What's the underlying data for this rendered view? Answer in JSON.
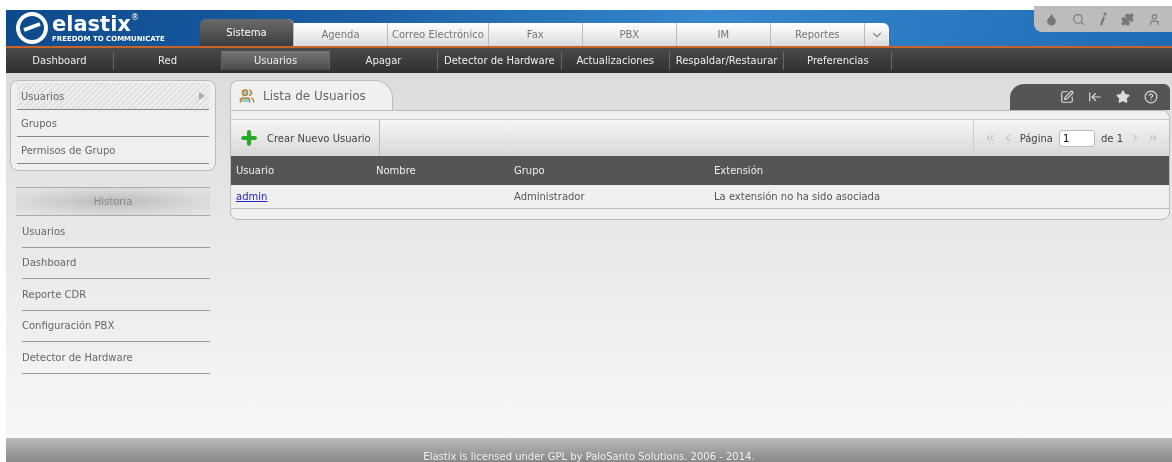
{
  "logo": {
    "name": "elastix",
    "mark": "®",
    "tagline": "FREEDOM TO COMMUNICATE"
  },
  "tabs": [
    {
      "label": "Sistema",
      "selected": true
    },
    {
      "label": "Agenda",
      "selected": false
    },
    {
      "label": "Correo Electrónico",
      "selected": false
    },
    {
      "label": "Fax",
      "selected": false
    },
    {
      "label": "PBX",
      "selected": false
    },
    {
      "label": "IM",
      "selected": false
    },
    {
      "label": "Reportes",
      "selected": false
    }
  ],
  "subnav": [
    {
      "label": "Dashboard",
      "selected": false
    },
    {
      "label": "Red",
      "selected": false
    },
    {
      "label": "Usuarios",
      "selected": true
    },
    {
      "label": "Apagar",
      "selected": false
    },
    {
      "label": "Detector de Hardware",
      "selected": false
    },
    {
      "label": "Actualizaciones",
      "selected": false
    },
    {
      "label": "Respaldar/Restaurar",
      "selected": false
    },
    {
      "label": "Preferencias",
      "selected": false
    }
  ],
  "sidebar": {
    "items": [
      {
        "label": "Usuarios",
        "selected": true
      },
      {
        "label": "Grupos",
        "selected": false
      },
      {
        "label": "Permisos de Grupo",
        "selected": false
      }
    ],
    "history_title": "Historia",
    "history": [
      "Usuarios",
      "Dashboard",
      "Reporte CDR",
      "Configuración PBX",
      "Detector de Hardware"
    ]
  },
  "panel": {
    "title": "Lista de Usuarios",
    "create_button": "Crear Nuevo Usuario",
    "pager": {
      "label": "Página",
      "page": "1",
      "of": "de 1"
    },
    "table": {
      "columns": [
        "Usuario",
        "Nombre",
        "Grupo",
        "Extensión"
      ],
      "rows": [
        {
          "user": "admin",
          "name": "",
          "group": "Administrador",
          "extension": "La extensión no ha sido asociada"
        }
      ]
    }
  },
  "footer": "Elastix is licensed under GPL by PaloSanto Solutions. 2006 - 2014."
}
